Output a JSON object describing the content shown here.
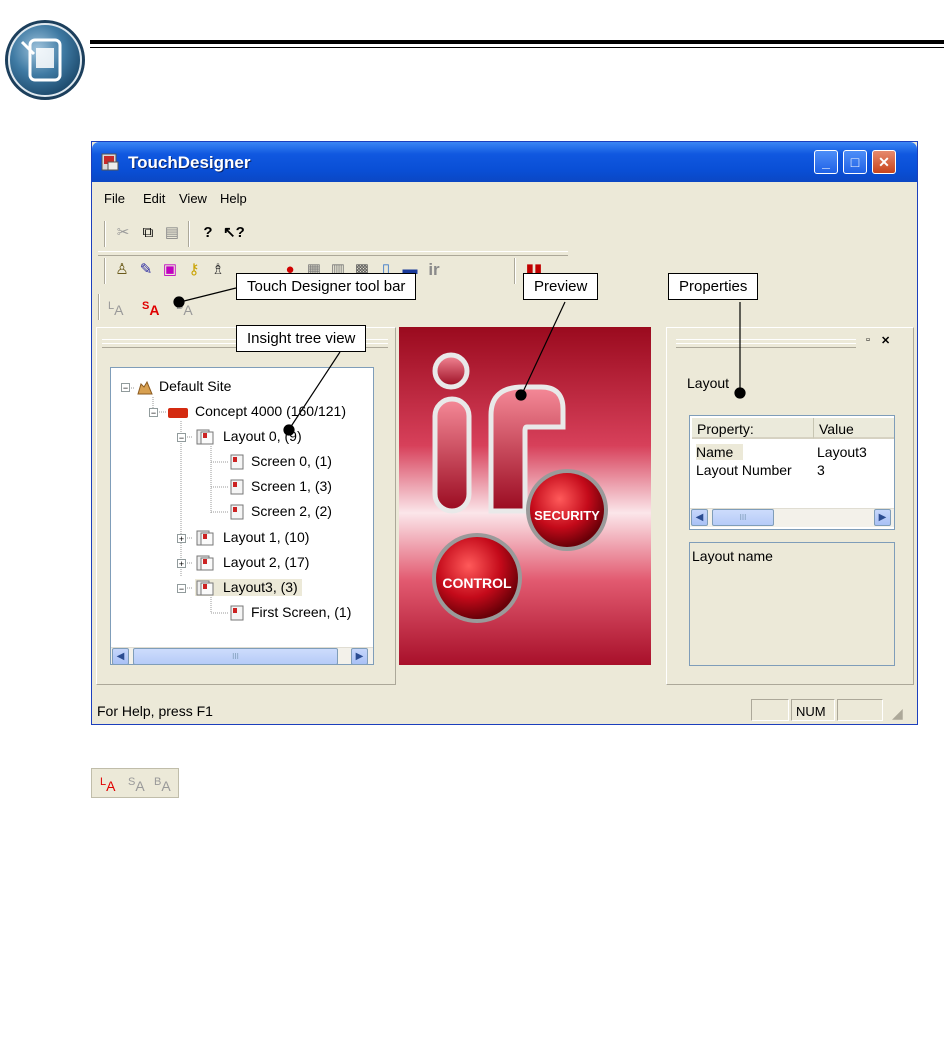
{
  "window": {
    "title": "TouchDesigner",
    "minimize_glyph": "_",
    "maximize_glyph": "□",
    "close_glyph": "✕"
  },
  "menu": [
    "File",
    "Edit",
    "View",
    "Help"
  ],
  "toolbar_labels": {
    "layout": "L",
    "screen": "S",
    "button": "B",
    "sub": "A"
  },
  "tree": {
    "items": [
      {
        "label": "Default Site",
        "icon": "site-icon"
      },
      {
        "label": "Concept 4000 (160/121)",
        "icon": "panel-icon"
      },
      {
        "label": "Layout 0, (9)",
        "icon": "layout-icon"
      },
      {
        "label": "Screen 0, (1)",
        "icon": "screen-icon"
      },
      {
        "label": "Screen 1, (3)",
        "icon": "screen-icon"
      },
      {
        "label": "Screen 2, (2)",
        "icon": "screen-icon"
      },
      {
        "label": "Layout 1, (10)",
        "icon": "layout-icon"
      },
      {
        "label": "Layout 2, (17)",
        "icon": "layout-icon"
      },
      {
        "label": "Layout3, (3)",
        "icon": "layout-icon"
      },
      {
        "label": "First Screen, (1)",
        "icon": "screen-icon"
      }
    ],
    "selected": "Layout3, (3)",
    "scroll_thumb": "III"
  },
  "preview": {
    "security_label": "SECURITY",
    "control_label": "CONTROL",
    "logo_text": "ir"
  },
  "properties": {
    "section_label": "Layout",
    "columns": [
      "Property:",
      "Value"
    ],
    "rows": [
      {
        "property": "Name",
        "value": "Layout3"
      },
      {
        "property": "Layout Number",
        "value": "3"
      }
    ],
    "scroll_thumb": "III",
    "description": "Layout name"
  },
  "status": {
    "text": "For Help, press F1",
    "num": "NUM"
  },
  "callouts": {
    "toolbar": "Touch Designer tool bar",
    "preview": "Preview",
    "properties": "Properties",
    "tree": "Insight tree view"
  },
  "colors": {
    "titlebar": "#0a4fd6",
    "window_bg": "#ece9d8",
    "preview_red": "#c4142c",
    "toolbar_red": "#e00000"
  }
}
